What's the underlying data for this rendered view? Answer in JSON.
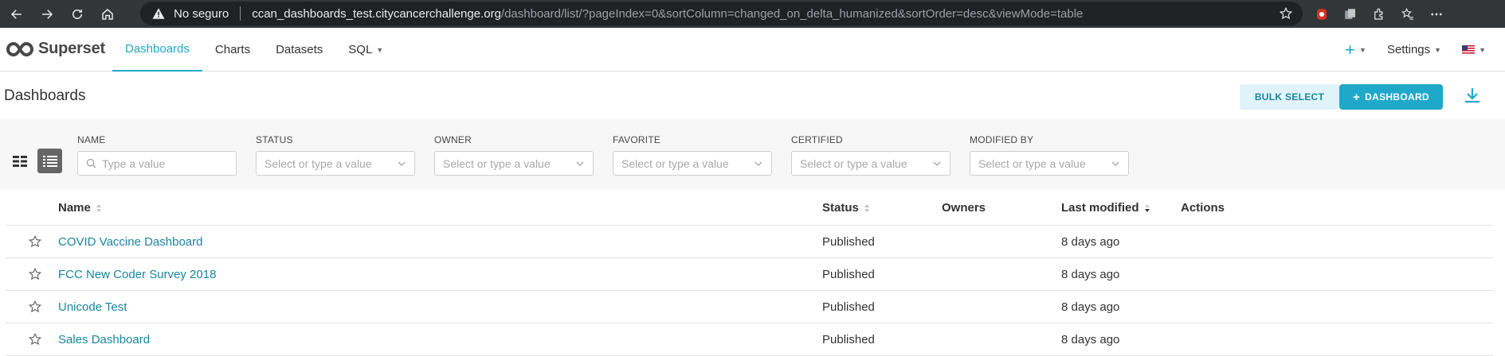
{
  "browser": {
    "security_label": "No seguro",
    "url_host": "ccan_dashboards_test.citycancerchallenge.org",
    "url_path": "/dashboard/list/?pageIndex=0&sortColumn=changed_on_delta_humanized&sortOrder=desc&viewMode=table",
    "icons": [
      "back-icon",
      "forward-icon",
      "reload-icon",
      "home-icon",
      "warning-icon",
      "star-icon",
      "extension-icon",
      "menu-icon"
    ]
  },
  "header": {
    "brand": "Superset",
    "nav": [
      {
        "label": "Dashboards"
      },
      {
        "label": "Charts"
      },
      {
        "label": "Datasets"
      },
      {
        "label": "SQL"
      }
    ],
    "settings_label": "Settings",
    "plus_label": "+"
  },
  "subheader": {
    "title": "Dashboards",
    "bulk_select_label": "BULK SELECT",
    "add_dashboard_label": "DASHBOARD",
    "add_dashboard_prefix": "+"
  },
  "filters": {
    "name": {
      "label": "NAME",
      "placeholder": "Type a value"
    },
    "status": {
      "label": "STATUS",
      "placeholder": "Select or type a value"
    },
    "owner": {
      "label": "OWNER",
      "placeholder": "Select or type a value"
    },
    "favorite": {
      "label": "FAVORITE",
      "placeholder": "Select or type a value"
    },
    "certified": {
      "label": "CERTIFIED",
      "placeholder": "Select or type a value"
    },
    "modified_by": {
      "label": "MODIFIED BY",
      "placeholder": "Select or type a value"
    }
  },
  "table": {
    "columns": {
      "name": "Name",
      "status": "Status",
      "owners": "Owners",
      "last_modified": "Last modified",
      "actions": "Actions"
    },
    "rows": [
      {
        "name": "COVID Vaccine Dashboard",
        "status": "Published",
        "modified": "8 days ago"
      },
      {
        "name": "FCC New Coder Survey 2018",
        "status": "Published",
        "modified": "8 days ago"
      },
      {
        "name": "Unicode Test",
        "status": "Published",
        "modified": "8 days ago"
      },
      {
        "name": "Sales Dashboard",
        "status": "Published",
        "modified": "8 days ago"
      }
    ]
  },
  "colors": {
    "primary": "#1fa8c9",
    "link": "#1a85a0",
    "chrome": "#323639"
  }
}
